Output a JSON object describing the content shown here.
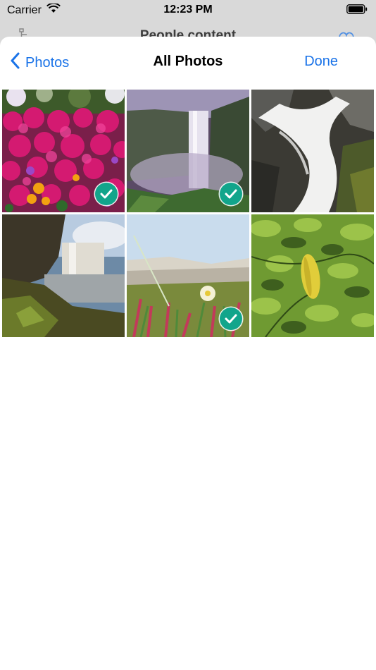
{
  "status_bar": {
    "carrier": "Carrier",
    "time": "12:23 PM"
  },
  "background_screen": {
    "title": "People content"
  },
  "sheet": {
    "back_label": "Photos",
    "title": "All Photos",
    "done_label": "Done"
  },
  "photos": [
    {
      "subject": "pink flowers",
      "selected": true
    },
    {
      "subject": "waterfall in valley",
      "selected": true
    },
    {
      "subject": "waterfall over rocks",
      "selected": false
    },
    {
      "subject": "waterfall at coast",
      "selected": false
    },
    {
      "subject": "beach flowers and grass",
      "selected": true
    },
    {
      "subject": "green leaves",
      "selected": false
    }
  ],
  "colors": {
    "accent": "#1a73e8",
    "selected_badge": "#12a58b"
  }
}
